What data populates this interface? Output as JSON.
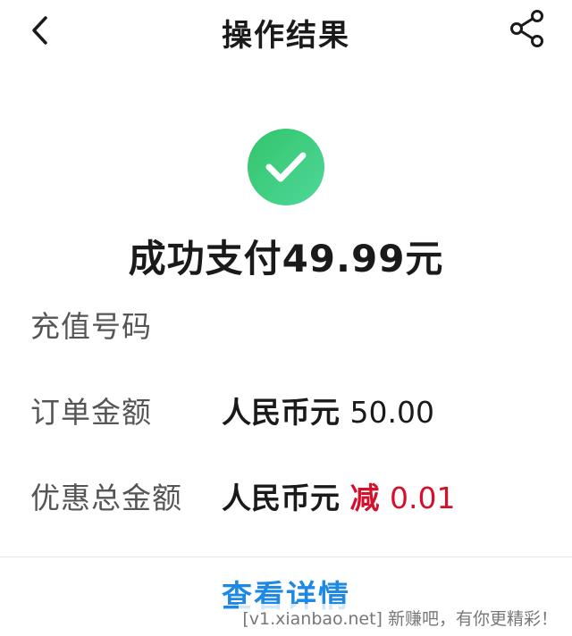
{
  "header": {
    "title": "操作结果",
    "back_icon": "chevron-left-icon",
    "share_icon": "share-icon"
  },
  "result": {
    "status_icon": "check-circle-icon",
    "status_color": "#3dcc7a",
    "title": "成功支付49.99元"
  },
  "details": {
    "recharge_number_label": "充值号码",
    "recharge_number_value": "",
    "order_amount_label": "订单金额",
    "order_amount_currency": "人民币元",
    "order_amount_value": "50.00",
    "discount_label": "优惠总金额",
    "discount_currency": "人民币元",
    "discount_prefix": "减",
    "discount_value": "0.01",
    "discount_color": "#d6102a"
  },
  "footer": {
    "view_details_label": "查看详情",
    "link_color": "#1e88e5"
  },
  "watermark": {
    "text": "[v1.xianbao.net] 新赚吧，有你更精彩！"
  }
}
